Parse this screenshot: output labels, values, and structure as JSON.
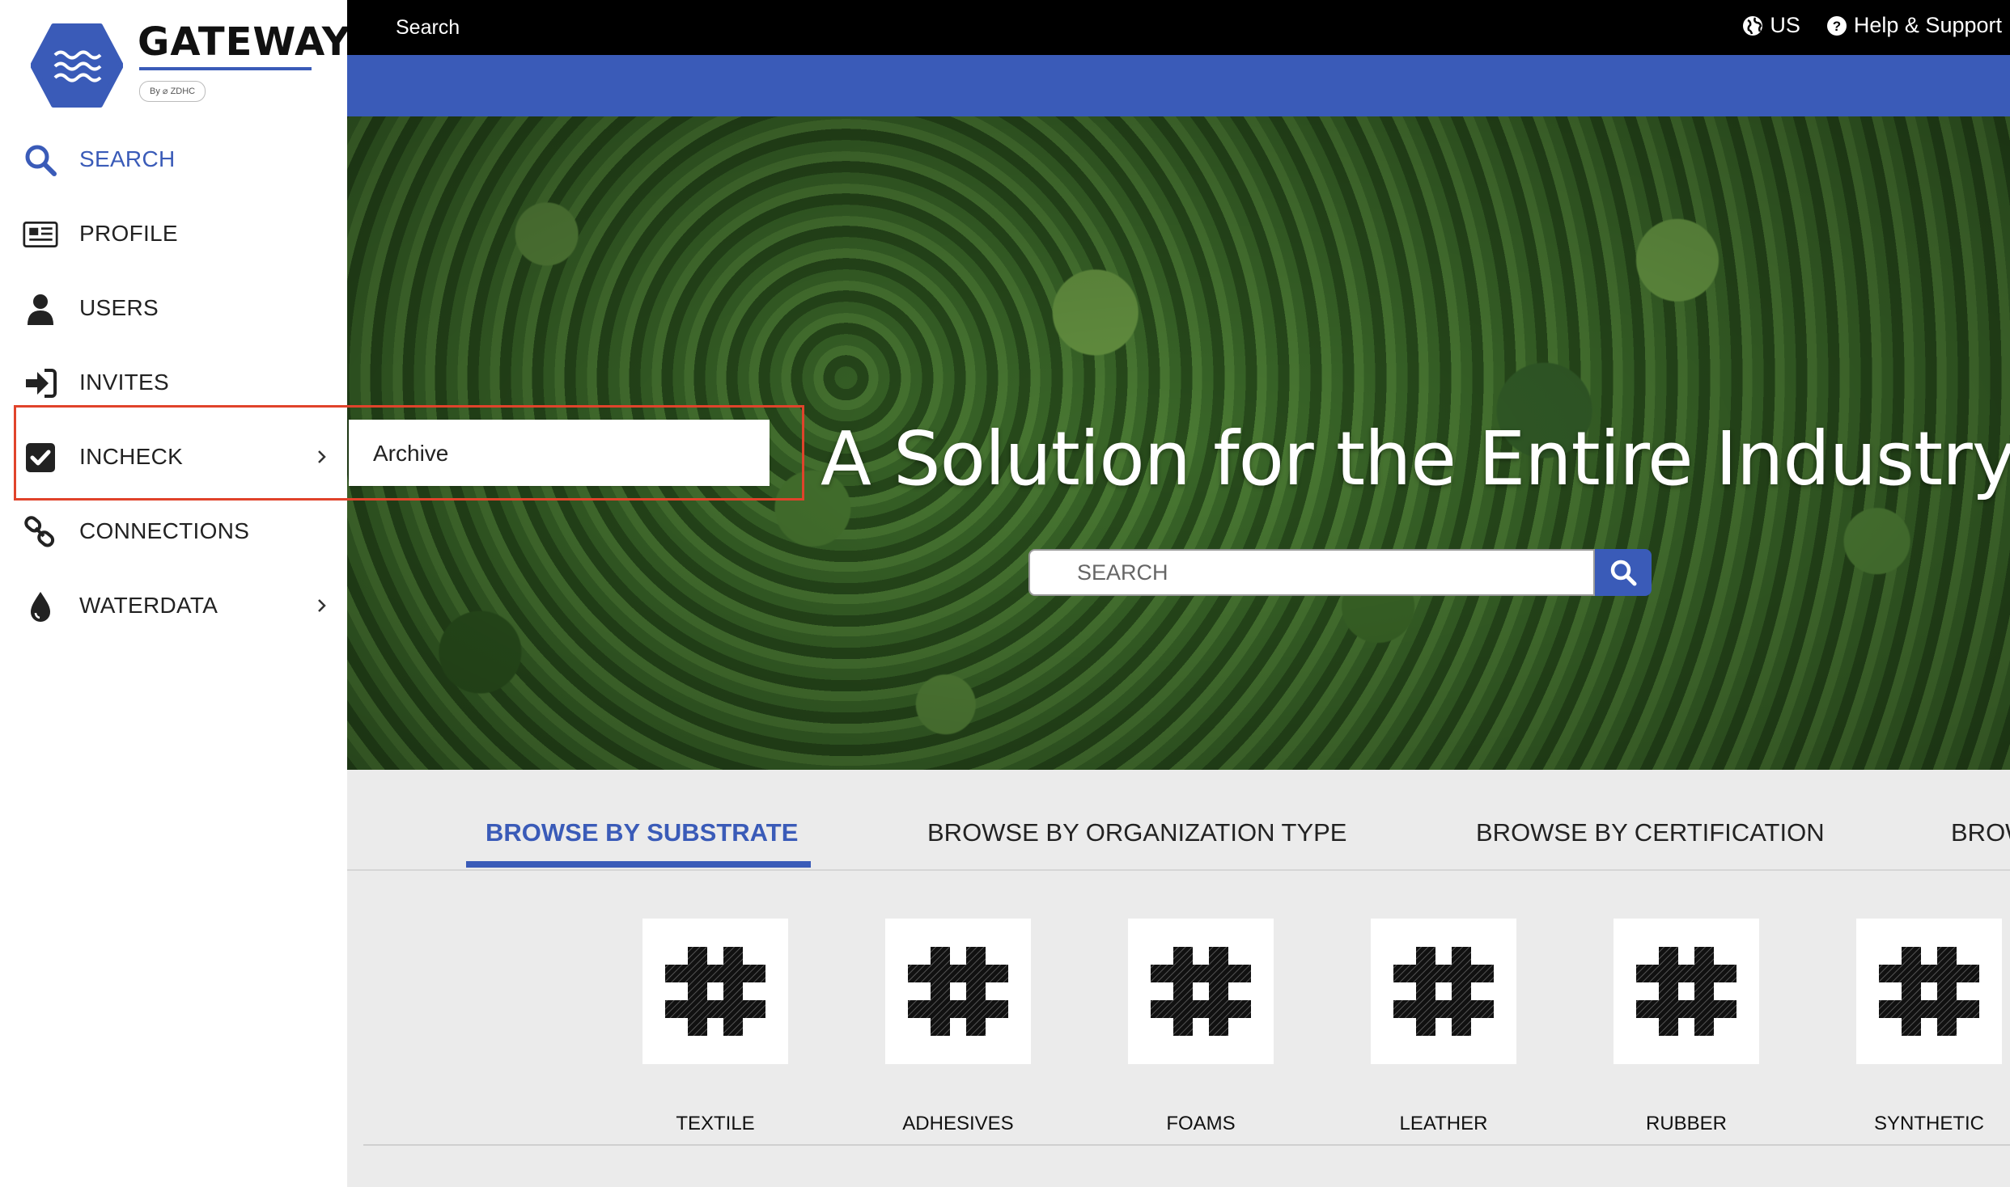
{
  "brand": {
    "title": "GATEWAY",
    "byline": "By ⌀ ZDHC",
    "color": "#3a5bb8"
  },
  "sidebar": {
    "items": [
      {
        "label": "SEARCH",
        "icon": "search-icon",
        "active": true
      },
      {
        "label": "PROFILE",
        "icon": "newspaper-icon"
      },
      {
        "label": "USERS",
        "icon": "user-icon"
      },
      {
        "label": "INVITES",
        "icon": "sign-in-icon"
      },
      {
        "label": "INCHECK",
        "icon": "checkbox-icon",
        "has_submenu": true
      },
      {
        "label": "CONNECTIONS",
        "icon": "link-icon"
      },
      {
        "label": "WATERDATA",
        "icon": "water-drop-icon",
        "has_submenu": true
      }
    ],
    "submenu": {
      "items": [
        {
          "label": "Archive"
        }
      ]
    }
  },
  "topbar": {
    "search_label": "Search",
    "region_label": "US",
    "help_label": "Help & Support"
  },
  "hero": {
    "title": "A Solution for the Entire Industry",
    "search_placeholder": "SEARCH"
  },
  "browse": {
    "tabs": [
      {
        "label": "BROWSE BY SUBSTRATE",
        "active": true
      },
      {
        "label": "BROWSE BY ORGANIZATION TYPE"
      },
      {
        "label": "BROWSE BY CERTIFICATION"
      },
      {
        "label": "BROW"
      }
    ],
    "substrates": [
      {
        "label": "TEXTILE",
        "icon": "textile-weave-icon"
      },
      {
        "label": "ADHESIVES",
        "icon": "textile-weave-icon"
      },
      {
        "label": "FOAMS",
        "icon": "textile-weave-icon"
      },
      {
        "label": "LEATHER",
        "icon": "textile-weave-icon"
      },
      {
        "label": "RUBBER",
        "icon": "textile-weave-icon"
      },
      {
        "label": "SYNTHETIC",
        "icon": "textile-weave-icon"
      }
    ]
  }
}
